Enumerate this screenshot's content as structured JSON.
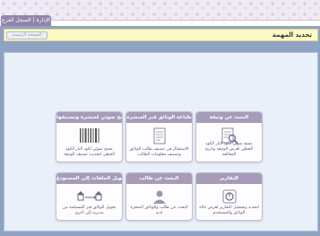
{
  "window": {
    "tab_label": "الإدارة | السجل الفرع"
  },
  "taskbar": {
    "title": "تحديد المهمة",
    "back_label": "الصفحة الرئيسة"
  },
  "cards": [
    {
      "title": "البحث عن وثيقة",
      "desc": "مسح ضوئي لكود البار الكود الخطي لعرض الوثيقة وتاريخ المعالجة",
      "icon": "search-document-icon"
    },
    {
      "title": "طباعة الوثائق قبر المنشرة",
      "desc": "الاستقبال في تصنيف طالب الوثائق وتصنيف معلومات الطالب",
      "icon": "print-document-icon"
    },
    {
      "title": "مسح ضوئي لمنشرة وتصنيفها",
      "desc": "مسح ضوئي لكود البار الكود الخطي لتحديث تصنيف الوثيقة",
      "icon": "barcode-icon"
    },
    {
      "title": "التقارير",
      "desc": "لتحديد وتسجيل التقارير لعرض حالة الوثائق والمستخدم",
      "icon": "report-icon"
    },
    {
      "title": "البحث عن طالب",
      "desc": "البحث عن طالب والوثائق المنجزة لديه",
      "icon": "user-search-icon"
    },
    {
      "title": "تحويل الملفات إلى المستودع",
      "desc": "تحويل الوثائق قبر المستلمة من مديرية إلى أخرى",
      "icon": "transfer-icon"
    }
  ]
}
